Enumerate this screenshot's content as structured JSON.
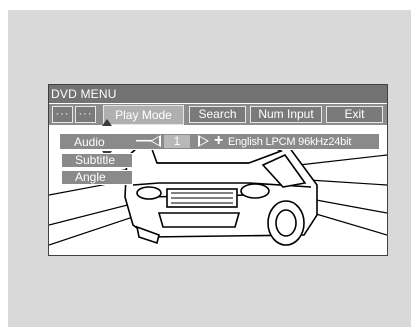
{
  "dvd_menu": {
    "title": "DVD MENU",
    "menu_buttons": [
      {
        "label": "···"
      },
      {
        "label": "···"
      },
      {
        "label": "Play Mode"
      },
      {
        "label": "Search"
      },
      {
        "label": "Num Input"
      },
      {
        "label": "Exit"
      }
    ],
    "play_mode_options": [
      {
        "label": "Audio"
      },
      {
        "label": "Subtitle"
      },
      {
        "label": "Angle"
      }
    ],
    "audio": {
      "minus": "—",
      "value": "1",
      "plus": "+",
      "info": "English LPCM 96kHz24bit"
    }
  },
  "colors": {
    "panel_bg": "#d9d9d9",
    "bar_bg": "#737373",
    "button_bg": "#8a8a8a",
    "active_button_bg": "#b0b0b0"
  }
}
